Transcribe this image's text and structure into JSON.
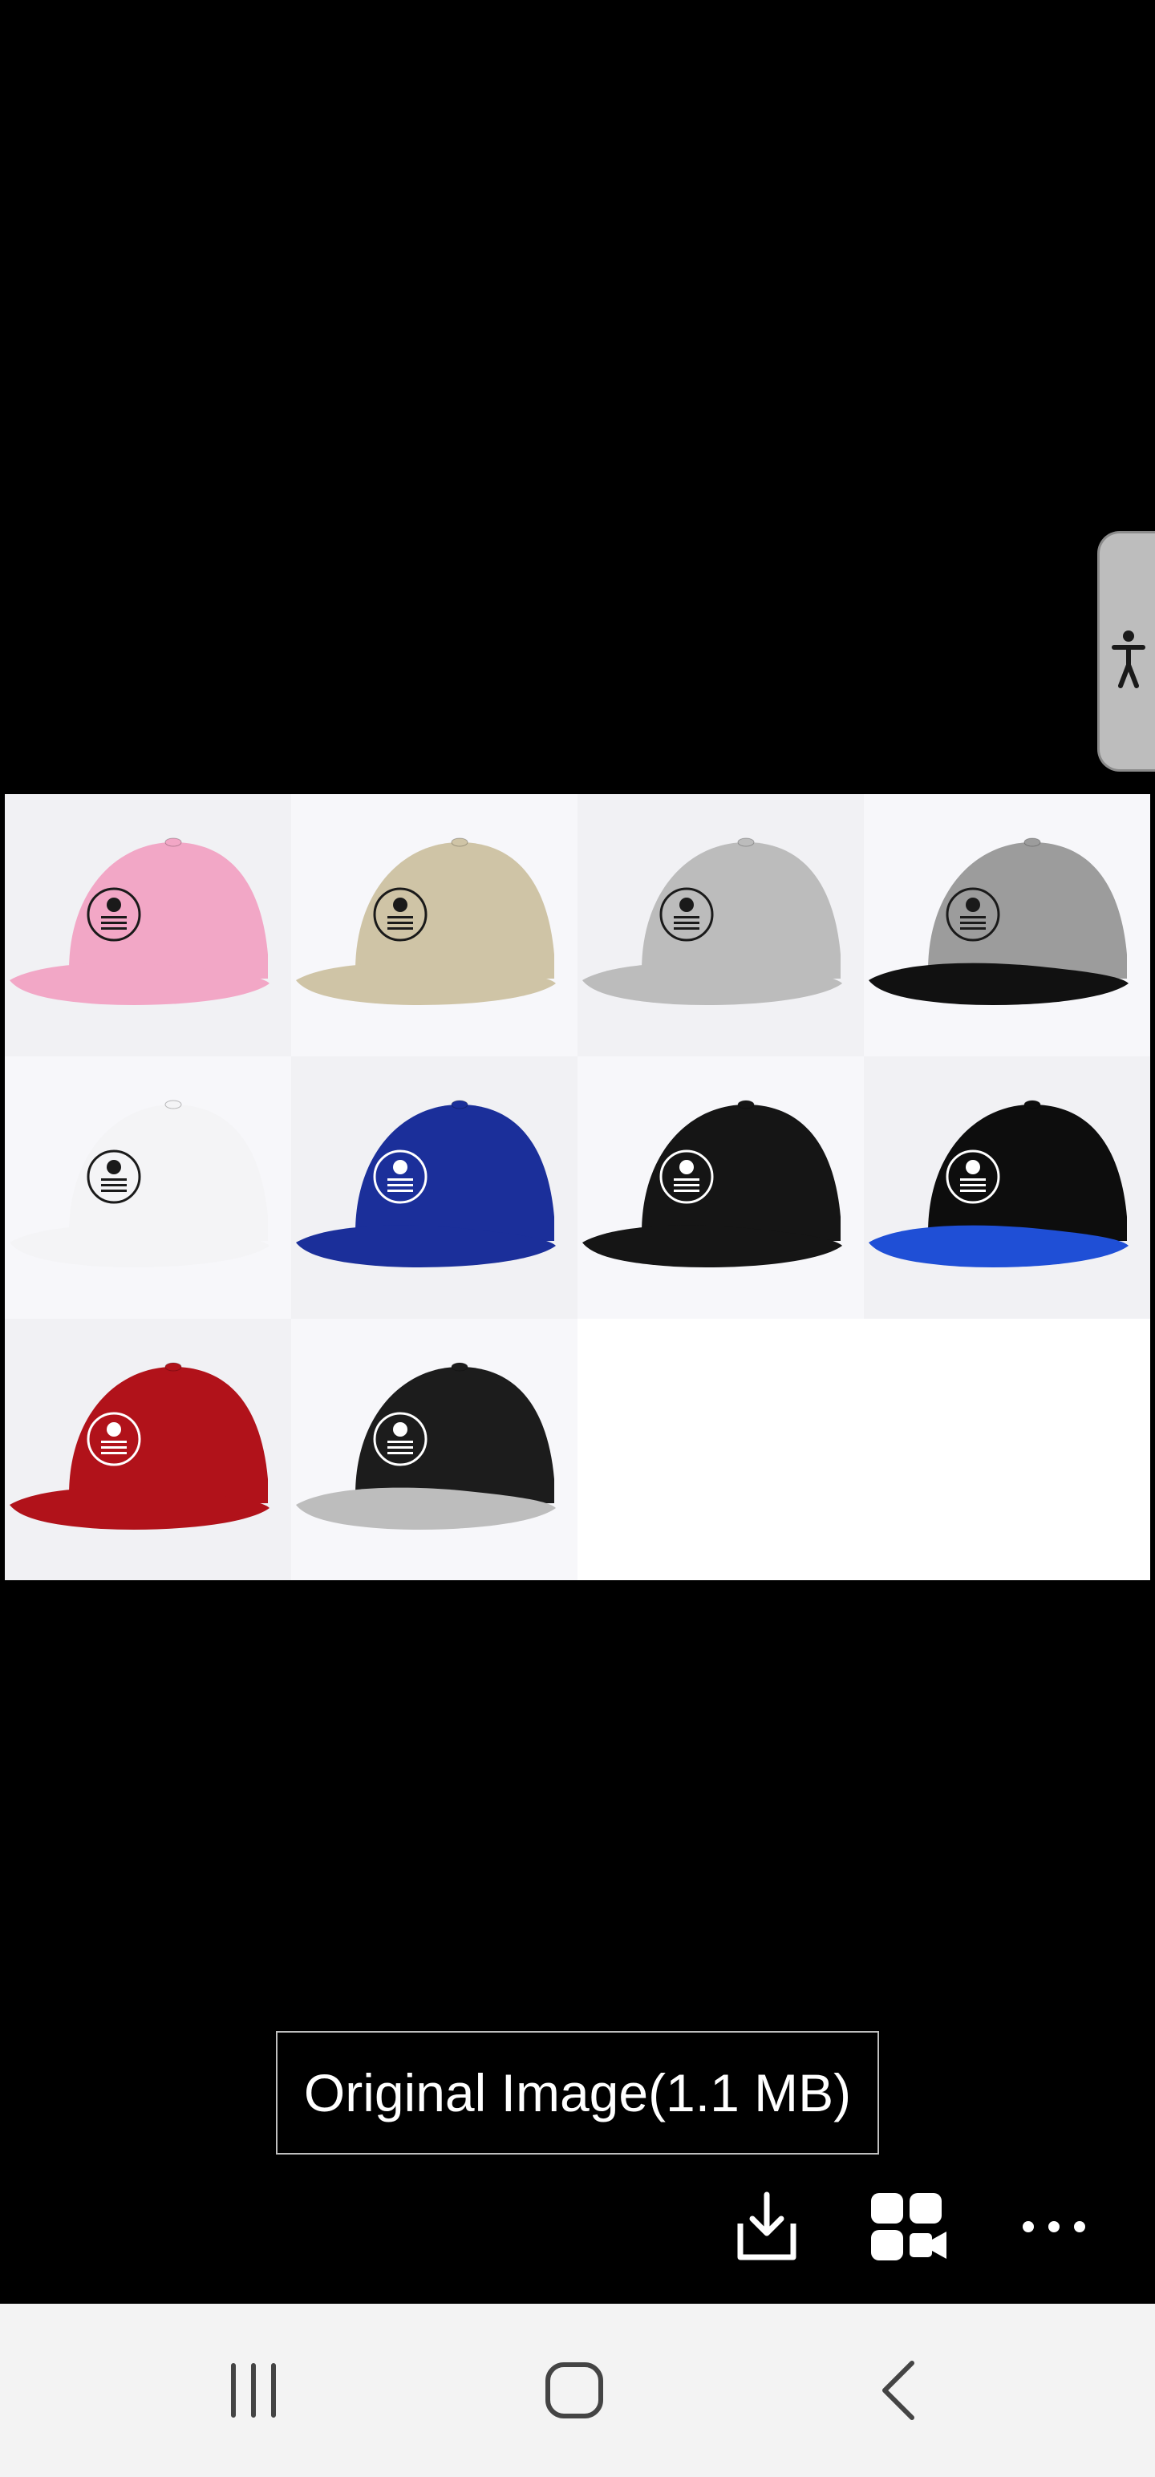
{
  "viewer": {
    "caption_button_label": "Original Image(1.1 MB)"
  },
  "photo": {
    "caps": [
      {
        "label": "pink cap",
        "crown": "#f2a7c6",
        "brim": "#f2a7c6"
      },
      {
        "label": "khaki cap",
        "crown": "#cfc4a6",
        "brim": "#cfc4a6"
      },
      {
        "label": "light grey cap",
        "crown": "#bcbcbc",
        "brim": "#bcbcbc"
      },
      {
        "label": "grey cap black brim",
        "crown": "#9c9c9c",
        "brim": "#111111"
      },
      {
        "label": "white cap",
        "crown": "#f4f4f6",
        "brim": "#f4f4f6"
      },
      {
        "label": "royal blue cap",
        "crown": "#1b2f9a",
        "brim": "#1b2f9a"
      },
      {
        "label": "black cap",
        "crown": "#151515",
        "brim": "#151515"
      },
      {
        "label": "black cap blue brim",
        "crown": "#0d0d0d",
        "brim": "#1f4fd6"
      },
      {
        "label": "red cap",
        "crown": "#b1121a",
        "brim": "#b1121a"
      },
      {
        "label": "black cap grey brim",
        "crown": "#1c1c1c",
        "brim": "#bdbdbd"
      }
    ]
  },
  "actions": [
    "download-icon",
    "collage-video-icon",
    "more-options-icon"
  ],
  "navigation": [
    "recent-apps-icon",
    "home-icon",
    "back-icon"
  ]
}
